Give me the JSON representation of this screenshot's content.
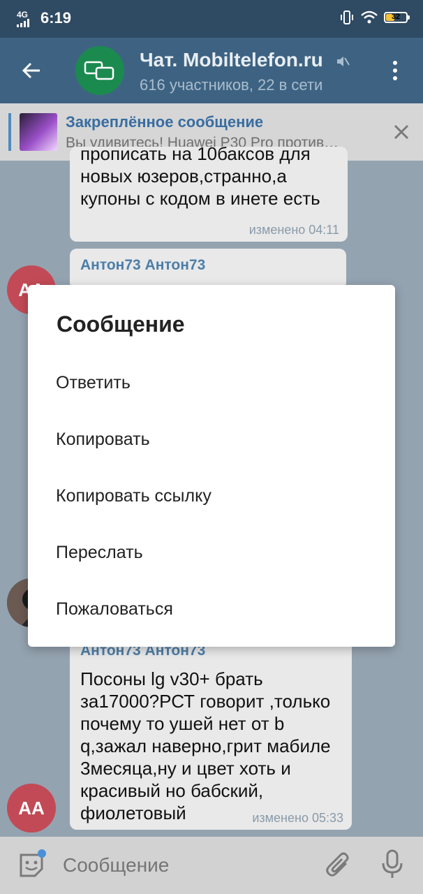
{
  "status_bar": {
    "network": "4G",
    "time": "6:19",
    "battery": "32"
  },
  "header": {
    "title": "Чат. Mobiltelefon.ru",
    "subtitle": "616 участников, 22 в сети"
  },
  "pinned": {
    "title": "Закреплённое сообщение",
    "text": "Вы удивитесь! Huawei P30 Pro против…"
  },
  "messages": [
    {
      "text_lines": [
        "прописать на 10баксов для",
        "новых юзеров,странно,а",
        "купоны с кодом в инете есть"
      ],
      "meta": "изменено 04:11"
    },
    {
      "sender": "Антон73 Антон73"
    },
    {
      "sender": "Антон73 Антон73",
      "text": "Посоны lg v30+ брать за17000?РСТ говорит ,только почему то ушей нет от b q,зажал наверно,грит мабиле 3месяца,ну и цвет хоть и красивый но бабский, фиолетовый",
      "meta": "изменено 05:33"
    }
  ],
  "avatars": {
    "initials": "АА"
  },
  "dialog": {
    "title": "Сообщение",
    "items": [
      "Ответить",
      "Копировать",
      "Копировать ссылку",
      "Переслать",
      "Пожаловаться"
    ]
  },
  "input": {
    "placeholder": "Сообщение"
  },
  "colors": {
    "header": "#3e6382",
    "accent": "#4f8bc0",
    "avatar_red": "#c24a56",
    "avatar_green": "#1b8a4f"
  }
}
